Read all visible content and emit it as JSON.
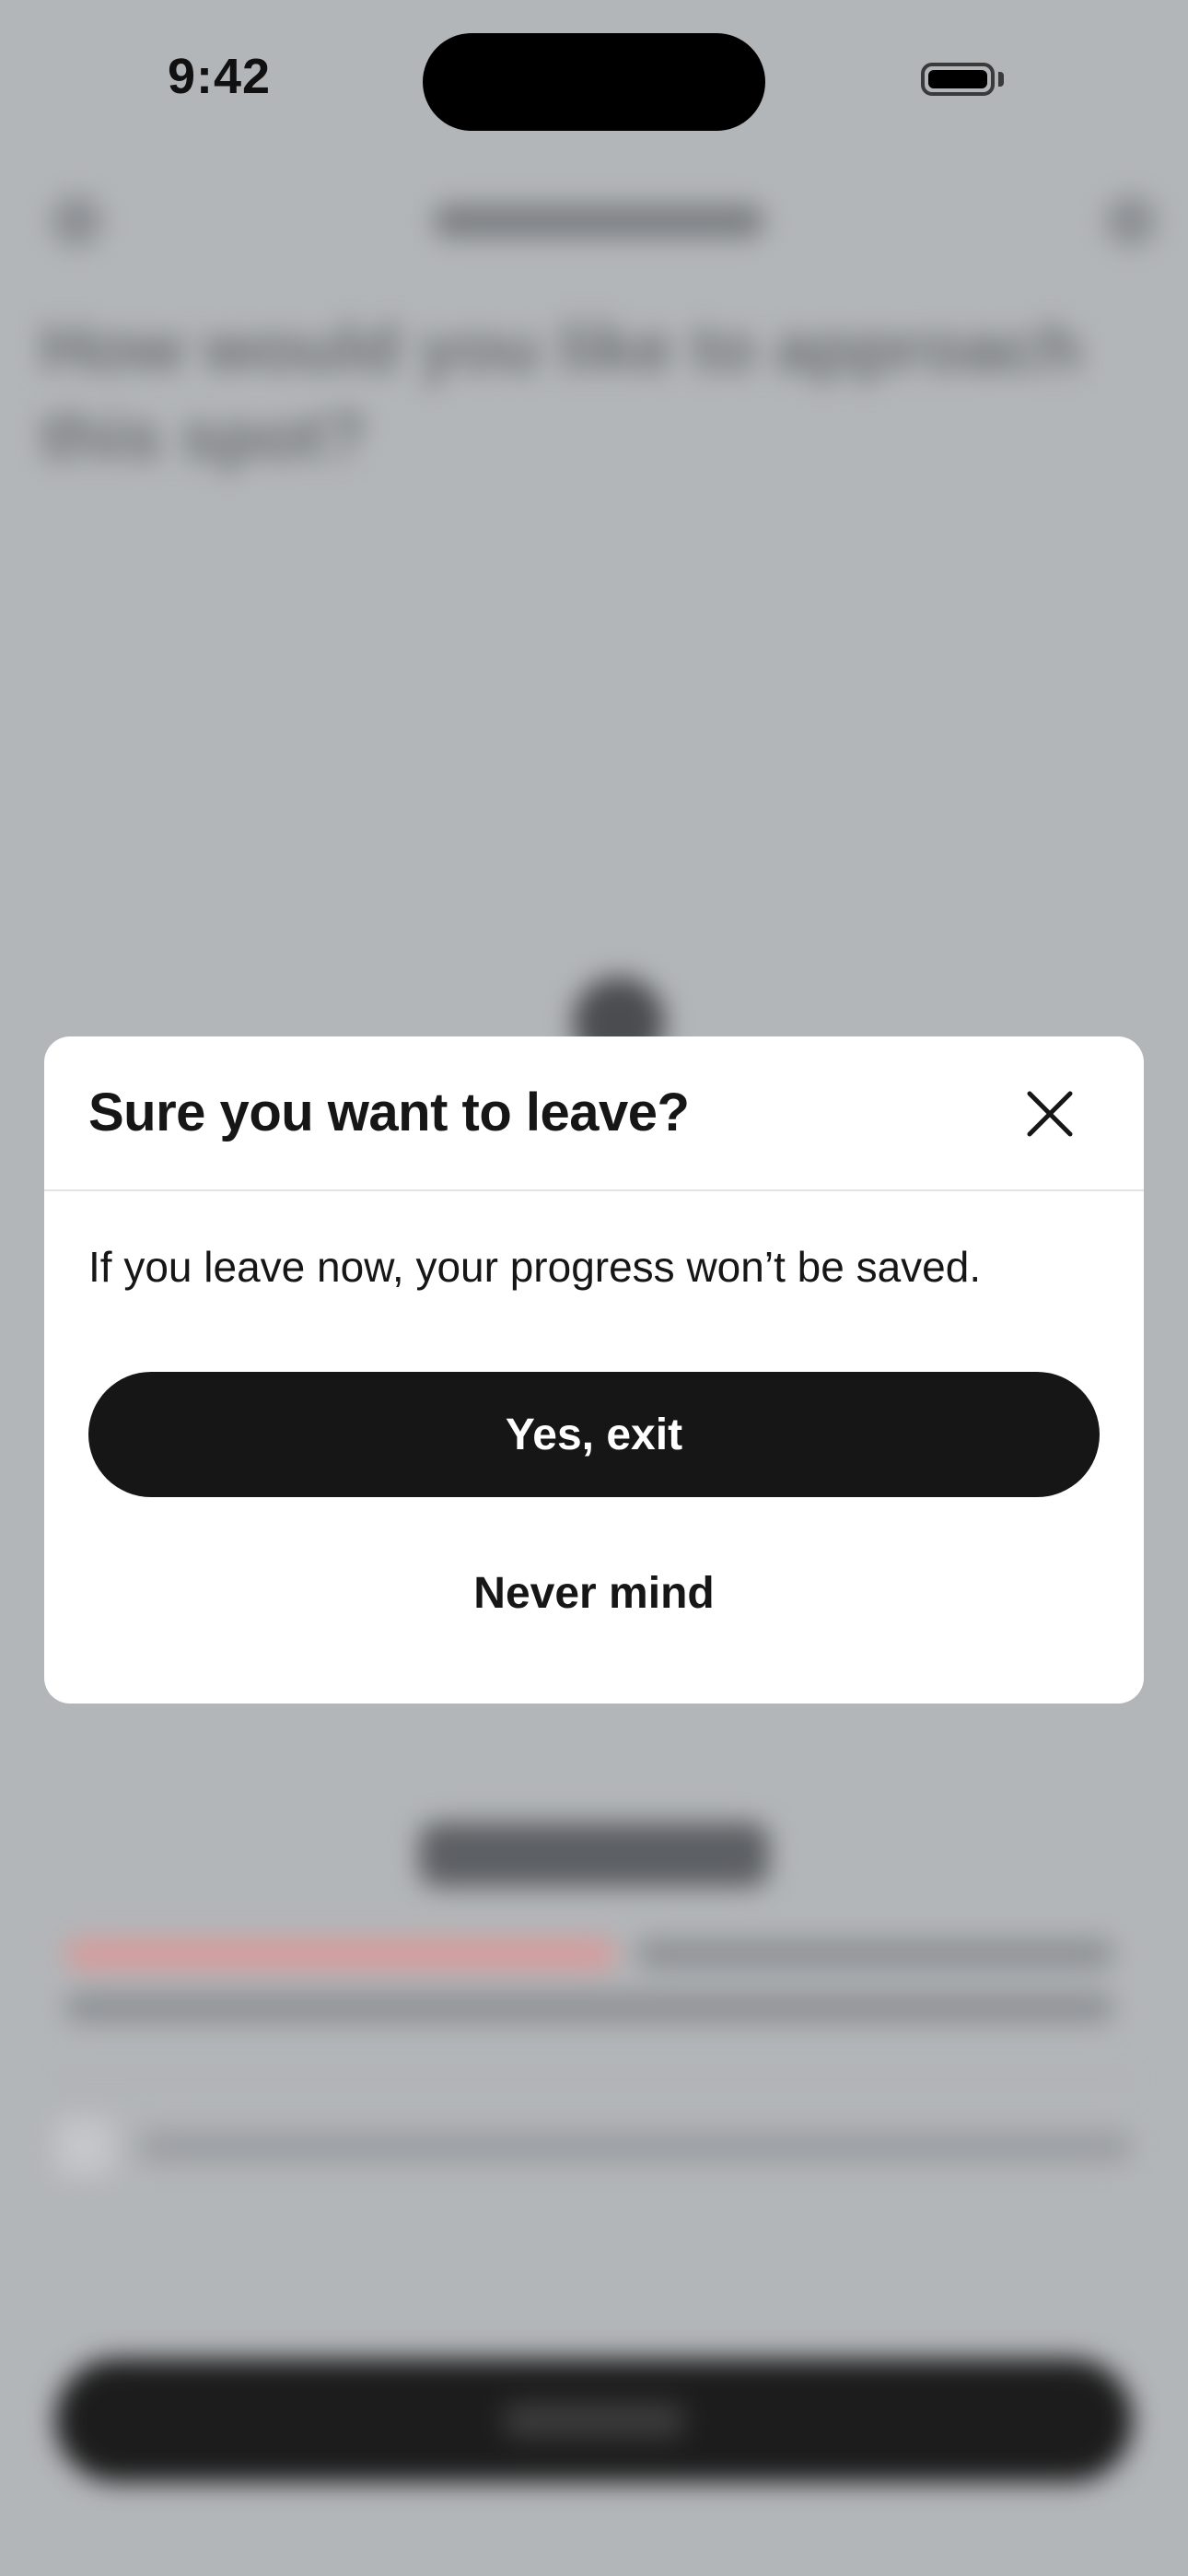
{
  "status_bar": {
    "time": "9:42",
    "battery_icon": "battery-full-icon"
  },
  "background_screen": {
    "question": "How would you like to approach this spot?"
  },
  "modal": {
    "title": "Sure you want to leave?",
    "close_icon": "close-icon",
    "message": "If you leave now, your progress won’t be saved.",
    "primary_label": "Yes, exit",
    "secondary_label": "Never mind"
  },
  "colors": {
    "overlay": "#b3b6b9",
    "modal_background": "#ffffff",
    "primary_button": "#161616",
    "primary_button_text": "#ffffff",
    "text": "#161616"
  }
}
